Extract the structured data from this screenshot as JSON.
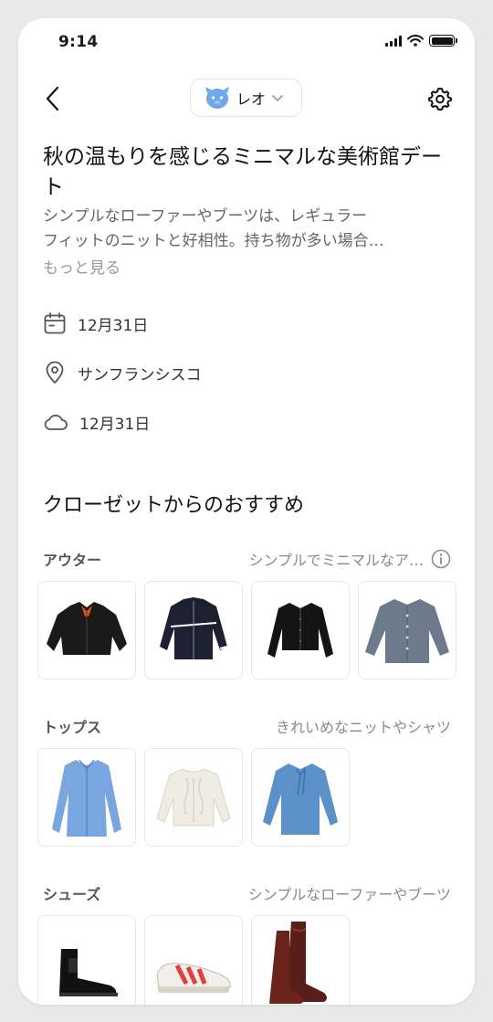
{
  "status_bar": {
    "time": "9:14"
  },
  "nav": {
    "character_name": "レオ"
  },
  "plan": {
    "title": "秋の温もりを感じるミニマルな美術館デート",
    "description_line1": "シンプルなローファーやブーツは、レギュラー",
    "description_line2": "フィットのニットと好相性。持ち物が多い場合…",
    "more_label": "もっと見る",
    "date": "12月31日",
    "location": "サンフランシスコ",
    "weather_date": "12月31日"
  },
  "recommendations": {
    "heading": "クローゼットからのおすすめ",
    "categories": [
      {
        "name": "アウター",
        "note": "シンプルでミニマルなア…",
        "items": [
          "black-bomber-jacket",
          "black-track-jacket",
          "black-cropped-jacket",
          "gray-cardigan"
        ]
      },
      {
        "name": "トップス",
        "note": "きれいめなニットやシャツ",
        "items": [
          "blue-oversized-shirt",
          "cream-cable-knit-sweater",
          "blue-bow-blouse"
        ]
      },
      {
        "name": "シューズ",
        "note": "シンプルなローファーやブーツ",
        "items": [
          "black-chelsea-boots",
          "red-white-running-shoes",
          "brown-knee-high-boots"
        ]
      }
    ]
  },
  "colors": {
    "accent_blue": "#6fa8e6",
    "muted_text": "#8a8a8a"
  }
}
